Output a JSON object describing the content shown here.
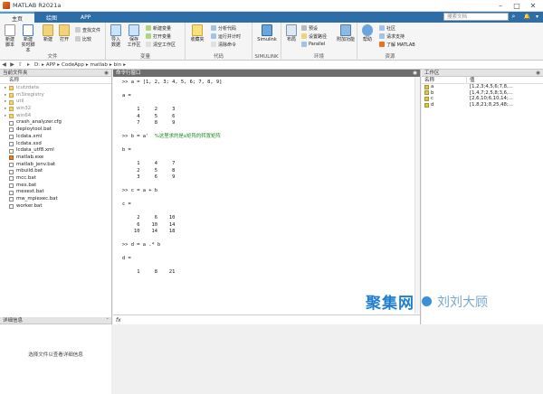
{
  "window": {
    "title": "MATLAB R2021a"
  },
  "tabs": [
    "主页",
    "绘图",
    "APP"
  ],
  "search": {
    "placeholder": "搜索文档"
  },
  "ribbon": {
    "file": {
      "label": "文件",
      "new_script": "新建\n脚本",
      "new_live": "新建\n实时脚本",
      "new": "新建",
      "open": "打开",
      "find_files": "查找文件",
      "compare": "比较"
    },
    "variable": {
      "label": "变量",
      "import": "导入\n数据",
      "save_ws": "保存\n工作区",
      "new_var": "新建变量",
      "open_var": "打开变量",
      "clear_ws": "清空工作区"
    },
    "code": {
      "label": "代码",
      "favorites": "收藏夹",
      "analyze": "分析代码",
      "run_time": "运行并计时",
      "clear_cmd": "清除命令"
    },
    "simulink": {
      "label": "SIMULINK",
      "simulink": "Simulink"
    },
    "env": {
      "label": "环境",
      "layout": "布局",
      "prefs": "预设",
      "set_path": "设置路径",
      "parallel": "Parallel",
      "addons": "附加功能"
    },
    "resources": {
      "label": "资源",
      "help": "帮助",
      "community": "社区",
      "support": "请求支持",
      "learn": "了解 MATLAB"
    }
  },
  "address": {
    "path": [
      "D:",
      "APP",
      "CodeApp",
      "matlab",
      "bin"
    ]
  },
  "current_folder": {
    "title": "当前文件夹",
    "column": "名称",
    "items": [
      {
        "name": "icutzdata",
        "type": "folder",
        "dim": true
      },
      {
        "name": "m3iregistry",
        "type": "folder",
        "dim": true
      },
      {
        "name": "util",
        "type": "folder",
        "dim": true
      },
      {
        "name": "win32",
        "type": "folder",
        "dim": true
      },
      {
        "name": "win64",
        "type": "folder",
        "dim": true
      },
      {
        "name": "crash_analyzer.cfg",
        "type": "file",
        "dim": false
      },
      {
        "name": "deploytool.bat",
        "type": "file",
        "dim": false
      },
      {
        "name": "lcdata.xml",
        "type": "file",
        "dim": false
      },
      {
        "name": "lcdata.xsd",
        "type": "file",
        "dim": false
      },
      {
        "name": "lcdata_utf8.xml",
        "type": "file",
        "dim": false
      },
      {
        "name": "matlab.exe",
        "type": "mfile",
        "dim": false
      },
      {
        "name": "matlab_jenv.bat",
        "type": "file",
        "dim": false
      },
      {
        "name": "mbuild.bat",
        "type": "file",
        "dim": false
      },
      {
        "name": "mcc.bat",
        "type": "file",
        "dim": false
      },
      {
        "name": "mex.bat",
        "type": "file",
        "dim": false
      },
      {
        "name": "mexext.bat",
        "type": "file",
        "dim": false
      },
      {
        "name": "mw_mpiexec.bat",
        "type": "file",
        "dim": false
      },
      {
        "name": "worker.bat",
        "type": "file",
        "dim": false
      }
    ]
  },
  "details": {
    "title": "详细信息",
    "message": "选择文件以查看详细信息"
  },
  "command_window": {
    "title": "命令行窗口",
    "lines": [
      {
        "t": ">> a = [1, 2, 3; 4, 5, 6; 7, 8, 9]",
        "c": ""
      },
      {
        "t": "",
        "c": ""
      },
      {
        "t": "a =",
        "c": ""
      },
      {
        "t": "",
        "c": ""
      },
      {
        "t": "     1     2     3",
        "c": ""
      },
      {
        "t": "     4     5     6",
        "c": ""
      },
      {
        "t": "     7     8     9",
        "c": ""
      },
      {
        "t": "",
        "c": ""
      },
      {
        "t": ">> b = a'  ",
        "c": "%这里求的是a矩阵的转置矩阵"
      },
      {
        "t": "",
        "c": ""
      },
      {
        "t": "b =",
        "c": ""
      },
      {
        "t": "",
        "c": ""
      },
      {
        "t": "     1     4     7",
        "c": ""
      },
      {
        "t": "     2     5     8",
        "c": ""
      },
      {
        "t": "     3     6     9",
        "c": ""
      },
      {
        "t": "",
        "c": ""
      },
      {
        "t": ">> c = a + b",
        "c": ""
      },
      {
        "t": "",
        "c": ""
      },
      {
        "t": "c =",
        "c": ""
      },
      {
        "t": "",
        "c": ""
      },
      {
        "t": "     2     6    10",
        "c": ""
      },
      {
        "t": "     6    10    14",
        "c": ""
      },
      {
        "t": "    10    14    18",
        "c": ""
      },
      {
        "t": "",
        "c": ""
      },
      {
        "t": ">> d = a .* b",
        "c": ""
      },
      {
        "t": "",
        "c": ""
      },
      {
        "t": "d =",
        "c": ""
      },
      {
        "t": "",
        "c": ""
      },
      {
        "t": "     1     8    21",
        "c": ""
      }
    ],
    "prompt": "fx"
  },
  "workspace": {
    "title": "工作区",
    "col_name": "名称",
    "col_value": "值",
    "vars": [
      {
        "name": "a",
        "value": "[1,2,3;4,5,6;7,8,..."
      },
      {
        "name": "b",
        "value": "[1,4,7;2,5,8;3,6,..."
      },
      {
        "name": "c",
        "value": "[2,6,10;6,10,14;..."
      },
      {
        "name": "d",
        "value": "[1,8,21;8,25,48;..."
      }
    ]
  },
  "watermark": {
    "text1": "聚集网",
    "text2": "刘刘大顾"
  },
  "colors": {
    "tabbar": "#2d6ea8",
    "cmd_header": "#6d6d6d",
    "comment": "#228b22"
  }
}
